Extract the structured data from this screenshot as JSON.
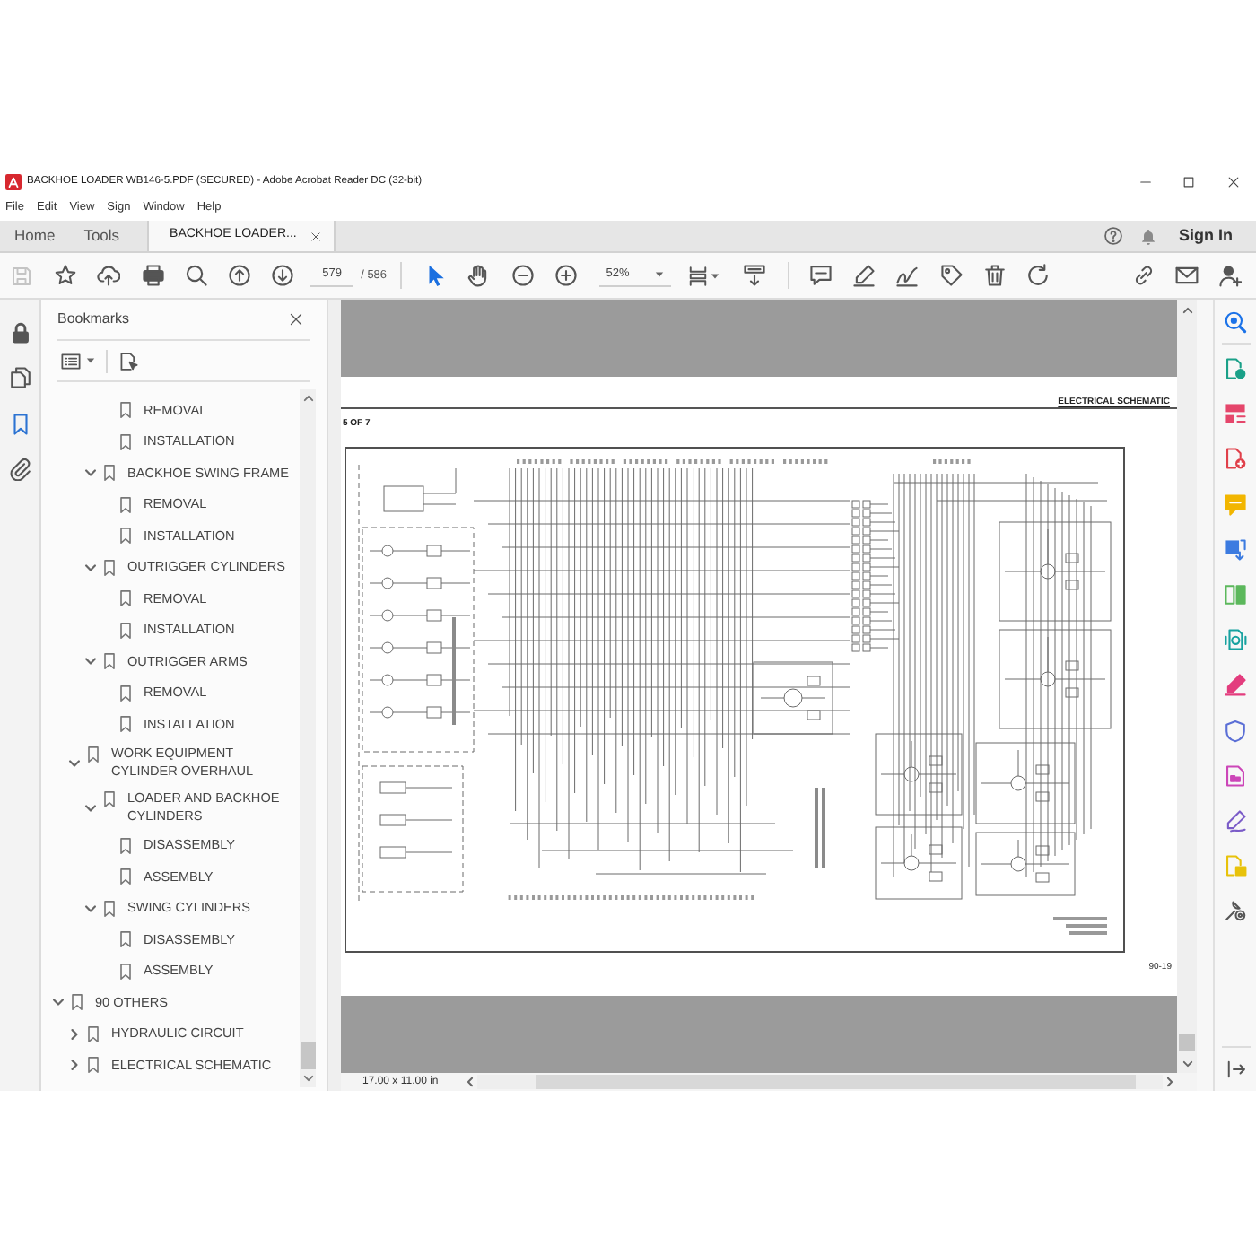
{
  "window": {
    "title": "BACKHOE LOADER WB146-5.PDF (SECURED) - Adobe Acrobat Reader DC (32-bit)"
  },
  "menu": [
    "File",
    "Edit",
    "View",
    "Sign",
    "Window",
    "Help"
  ],
  "tabs": [
    {
      "label": "Home",
      "selected": false
    },
    {
      "label": "Tools",
      "selected": false
    },
    {
      "label": "BACKHOE LOADER...",
      "selected": true,
      "closable": true
    }
  ],
  "account": {
    "sign_in": "Sign In"
  },
  "toolbar": {
    "save": {
      "disabled": true
    },
    "page": "579",
    "page_total": "/ 586",
    "tools": [
      {
        "selected": true
      },
      {
        "selected": false
      }
    ],
    "zoom": "52%"
  },
  "left_rail": [
    {
      "selected": false
    },
    {
      "selected": false
    },
    {
      "selected": true
    },
    {
      "selected": false
    }
  ],
  "sidebar": {
    "title": "Bookmarks",
    "bookmarks": [
      {
        "children": [
          {
            "children": [
              {
                "children": [
                  {
                    "label": "REMOVAL"
                  },
                  {
                    "label": "INSTALLATION"
                  }
                ]
              },
              {
                "label": "BACKHOE SWING FRAME",
                "expanded": true,
                "children": [
                  {
                    "label": "REMOVAL"
                  },
                  {
                    "label": "INSTALLATION"
                  }
                ]
              },
              {
                "label": "OUTRIGGER CYLINDERS",
                "expanded": true,
                "children": [
                  {
                    "label": "REMOVAL"
                  },
                  {
                    "label": "INSTALLATION"
                  }
                ]
              },
              {
                "label": "OUTRIGGER ARMS",
                "expanded": true,
                "children": [
                  {
                    "label": "REMOVAL"
                  },
                  {
                    "label": "INSTALLATION"
                  }
                ]
              }
            ]
          },
          {
            "label": "WORK EQUIPMENT CYLINDER OVERHAUL",
            "expanded": true,
            "children": [
              {
                "label": "LOADER AND BACKHOE CYLINDERS",
                "expanded": true,
                "children": [
                  {
                    "label": "DISASSEMBLY"
                  },
                  {
                    "label": "ASSEMBLY"
                  }
                ]
              },
              {
                "label": "SWING CYLINDERS",
                "expanded": true,
                "children": [
                  {
                    "label": "DISASSEMBLY"
                  },
                  {
                    "label": "ASSEMBLY"
                  }
                ]
              }
            ]
          }
        ]
      },
      {
        "label": "90 OTHERS",
        "expanded": true,
        "children": [
          {
            "label": "HYDRAULIC CIRCUIT",
            "expanded": false
          },
          {
            "label": "ELECTRICAL SCHEMATIC",
            "expanded": false
          }
        ]
      }
    ]
  },
  "document": {
    "header": "ELECTRICAL SCHEMATIC",
    "sheet": "5 OF 7",
    "page_number": "90-19"
  },
  "status_bar": {
    "page_size": "17.00 x 11.00 in"
  }
}
